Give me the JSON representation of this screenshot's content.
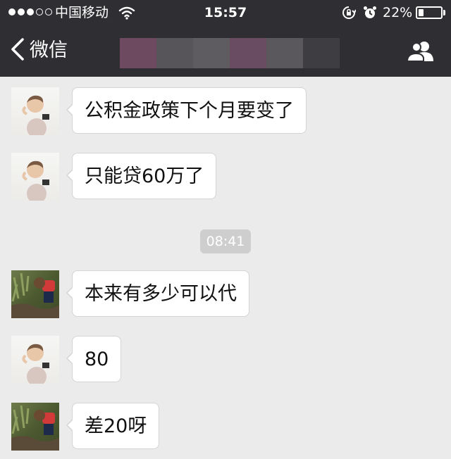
{
  "status_bar": {
    "carrier": "中国移动",
    "time": "15:57",
    "battery_percent": "22%",
    "battery_level": 0.22,
    "signal_strength": 3,
    "signal_max": 5
  },
  "nav": {
    "back_label": "微信",
    "title_blocks": [
      "#6e4a60",
      "#58555a",
      "#5e5c60",
      "#6a4c62",
      "#5a585c",
      "#3e3d42"
    ]
  },
  "colors": {
    "bar_bg": "#2e2e33",
    "chat_bg": "#ebebeb",
    "bubble_bg": "#ffffff",
    "timestamp_bg": "#cecece"
  },
  "messages": [
    {
      "sender": "baby",
      "text": "公积金政策下个月要变了"
    },
    {
      "sender": "baby",
      "text": "只能贷60万了"
    },
    {
      "sender": "garden",
      "text": "本来有多少可以代"
    },
    {
      "sender": "baby",
      "text": "80"
    },
    {
      "sender": "garden",
      "text": "差20呀"
    }
  ],
  "timestamp": "08:41",
  "icons": {
    "back": "chevron-left-icon",
    "contacts": "contacts-icon",
    "wifi": "wifi-icon",
    "rotation_lock": "rotation-lock-icon",
    "alarm": "alarm-clock-icon",
    "battery": "battery-icon"
  }
}
